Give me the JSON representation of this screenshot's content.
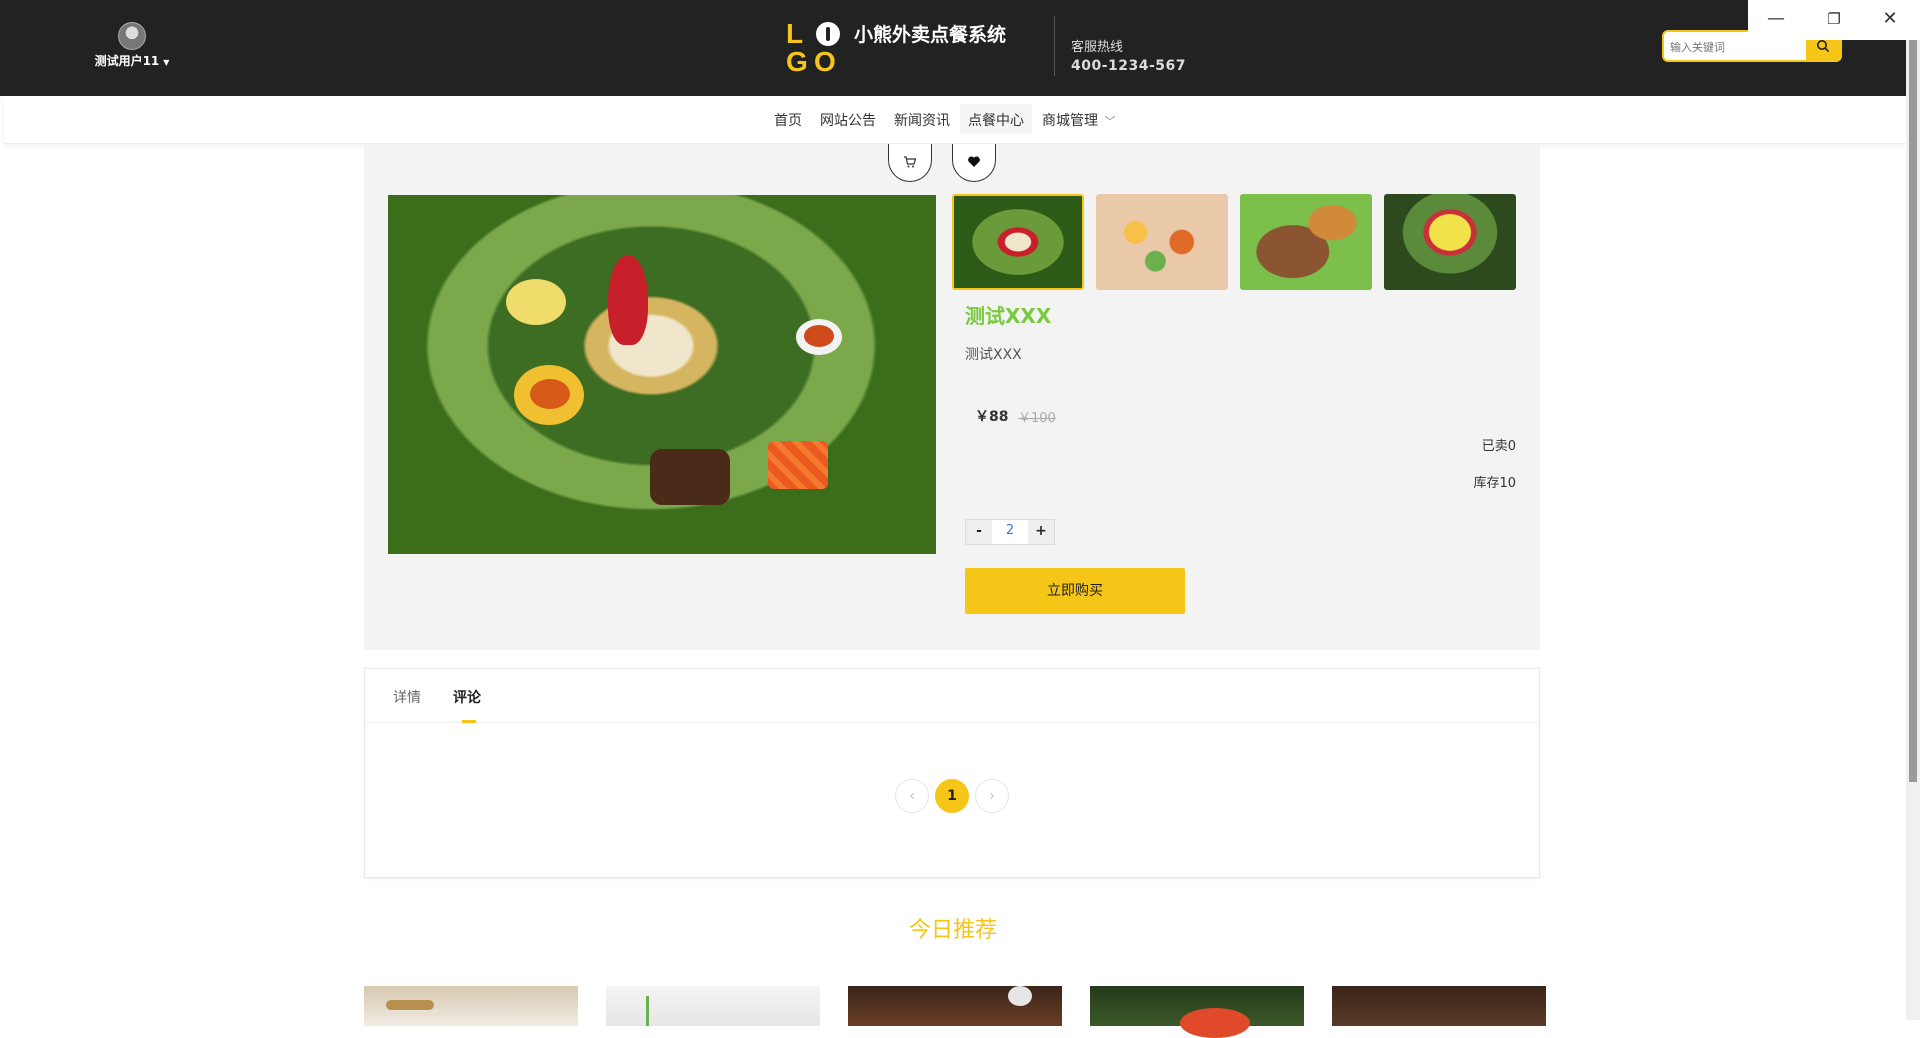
{
  "header": {
    "user_name": "测试用户11",
    "site_title": "小熊外卖点餐系统",
    "hotline_label": "客服热线",
    "hotline_number": "400-1234-567",
    "search_placeholder": "输入关键词",
    "logo_letters": [
      "L",
      "G",
      "O"
    ]
  },
  "window_controls": {
    "minimize": "—",
    "restore": "❐",
    "close": "✕"
  },
  "nav": {
    "items": [
      {
        "label": "首页"
      },
      {
        "label": "网站公告"
      },
      {
        "label": "新闻资讯"
      },
      {
        "label": "点餐中心"
      },
      {
        "label": "商城管理",
        "has_dropdown": true
      }
    ],
    "active": "点餐中心"
  },
  "product": {
    "name": "测试XXX",
    "subtitle": "测试XXX",
    "price": "￥88",
    "original_price": "￥100",
    "sold": "已卖0",
    "stock": "库存10",
    "quantity": "2",
    "minus": "-",
    "plus": "+",
    "buy_label": "立即购买",
    "thumbnails_count": 4,
    "icons": {
      "cart": "cart-icon",
      "favorite": "heart-icon"
    }
  },
  "tabs": {
    "items": [
      {
        "label": "详情"
      },
      {
        "label": "评论"
      }
    ],
    "active": "评论"
  },
  "pager": {
    "prev": "‹",
    "current": "1",
    "next": "›"
  },
  "recommend": {
    "title": "今日推荐",
    "items_count": 5
  },
  "colors": {
    "accent": "#f5c518",
    "title_green": "#7ac93f",
    "header_bg": "#222222"
  }
}
